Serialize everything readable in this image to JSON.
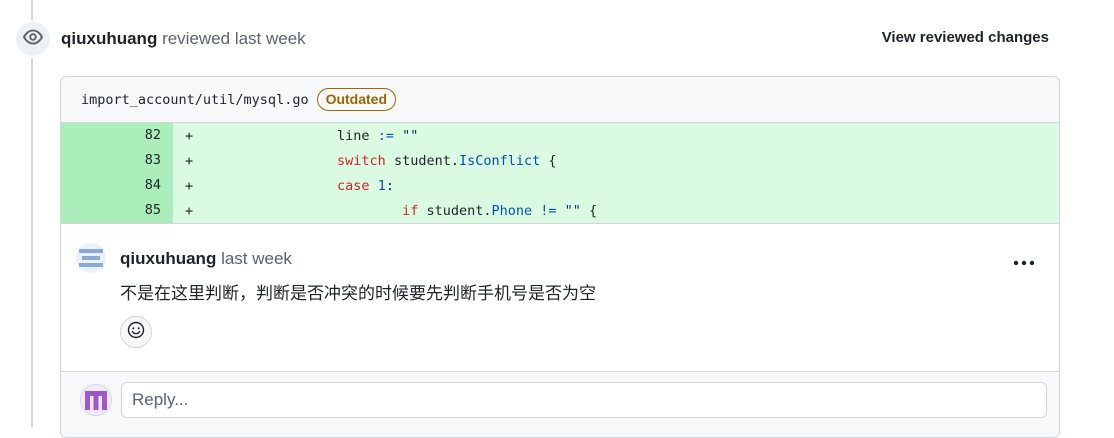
{
  "review": {
    "author": "qiuxuhuang",
    "action": "reviewed last week",
    "view_changes_label": "View reviewed changes"
  },
  "file": {
    "path": "import_account/util/mysql.go",
    "badge": "Outdated"
  },
  "diff": [
    {
      "line": "82",
      "sign": "+"
    },
    {
      "line": "83",
      "sign": "+"
    },
    {
      "line": "84",
      "sign": "+"
    },
    {
      "line": "85",
      "sign": "+"
    }
  ],
  "code": {
    "l82_a": "line ",
    "l82_op": ":=",
    "l82_str": " \"\"",
    "l83_kw": "switch",
    "l83_a": " student.",
    "l83_fn": "IsConflict",
    "l83_b": " {",
    "l84_kw": "case",
    "l84_num": " 1",
    "l84_b": ":",
    "l85_kw": "if",
    "l85_a": " student.",
    "l85_fn": "Phone",
    "l85_op": " !=",
    "l85_str": " \"\"",
    "l85_b": " {"
  },
  "comment": {
    "author": "qiuxuhuang",
    "time": "last week",
    "body": "不是在这里判断，判断是否冲突的时候要先判断手机号是否为空"
  },
  "reply": {
    "placeholder": "Reply..."
  },
  "icons": {
    "badge": "eye-icon",
    "more": "kebab-horizontal-icon",
    "reaction": "smiley-icon"
  },
  "colors": {
    "addition_bg": "#dafbe1",
    "addition_num_bg": "#aceebb",
    "outdated": "#9a6700"
  }
}
